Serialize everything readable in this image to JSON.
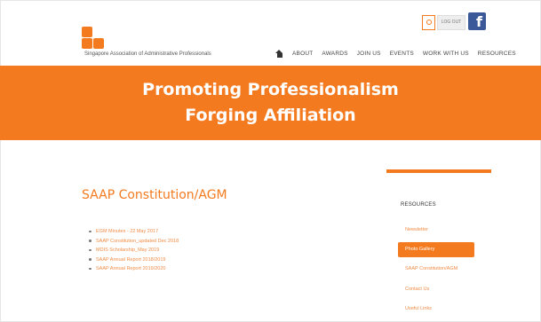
{
  "header": {
    "org_name": "Singapore Association of Administrative Professionals",
    "logout_label": "LOG OUT",
    "facebook_glyph": "f",
    "accent_color": "#f37a1f"
  },
  "nav": {
    "items": [
      "ABOUT",
      "AWARDS",
      "JOIN US",
      "EVENTS",
      "WORK WITH US",
      "RESOURCES"
    ]
  },
  "banner": {
    "line1": "Promoting Professionalism",
    "line2": "Forging Affiliation"
  },
  "main": {
    "title": "SAAP Constitution/AGM",
    "documents": [
      "EGM Minutes - 22 May 2017",
      "SAAP Constitution_updated Dec 2018",
      "MDIS Scholarship_May 2019",
      "SAAP Annual Report 2018/2019",
      "SAAP Annual Report 2019/2020"
    ]
  },
  "sidebar": {
    "heading": "RESOURCES",
    "items": [
      {
        "label": "Newsletter",
        "active": false
      },
      {
        "label": "Photo Gallery",
        "active": true
      },
      {
        "label": "SAAP Constitution/AGM",
        "active": false
      },
      {
        "label": "Contact Us",
        "active": false
      },
      {
        "label": "Useful Links",
        "active": false
      }
    ]
  }
}
